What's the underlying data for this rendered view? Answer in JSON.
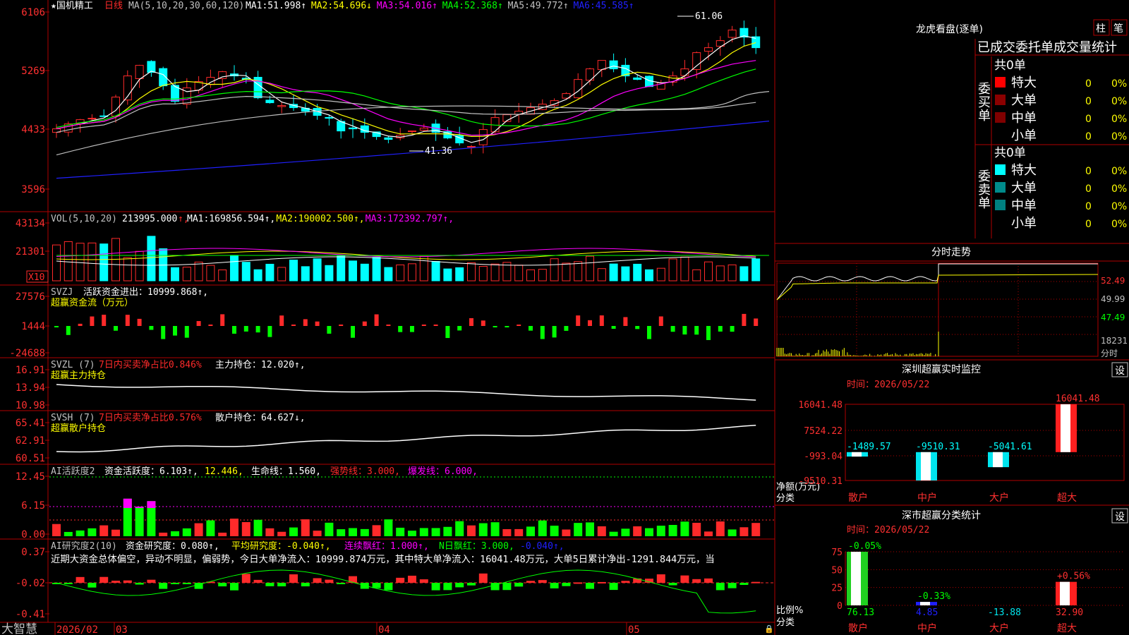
{
  "colors": {
    "up": "#ff2a2a",
    "down": "#00ffff",
    "frame": "#b00000",
    "bg": "#000000",
    "ma1": "#ffffff",
    "ma2": "#ffff00",
    "ma3": "#ff00ff",
    "ma4": "#00ff00",
    "ma5": "#c0c0c0",
    "ma6": "#2020ff",
    "green": "#00ff00",
    "magenta": "#ff00ff",
    "yellow": "#ffff00"
  },
  "candle": {
    "title": "★国机精工",
    "period": "日线",
    "ma_label": "MA(5,10,20,30,60,120)",
    "ma_values": [
      {
        "name": "MA1",
        "value": "51.998",
        "arrow": "↑"
      },
      {
        "name": "MA2",
        "value": "54.696",
        "arrow": "↓"
      },
      {
        "name": "MA3",
        "value": "54.016",
        "arrow": "↑"
      },
      {
        "name": "MA4",
        "value": "52.368",
        "arrow": "↑"
      },
      {
        "name": "MA5",
        "value": "49.772",
        "arrow": "↑"
      },
      {
        "name": "MA6",
        "value": "45.585",
        "arrow": "↑"
      }
    ],
    "y_ticks": [
      "6106",
      "5269",
      "4433",
      "3596"
    ],
    "high_label": "61.06",
    "low_label": "41.36"
  },
  "vol": {
    "label": "VOL(5,10,20)",
    "value": "213995.000",
    "ma": [
      {
        "name": "MA1",
        "value": "169856.594"
      },
      {
        "name": "MA2",
        "value": "190002.500"
      },
      {
        "name": "MA3",
        "value": "172392.797"
      }
    ],
    "y_ticks": [
      "43134",
      "21301"
    ],
    "unit": "X10"
  },
  "svzj": {
    "label": "SVZJ",
    "text": "活跃资金进出：10999.868↑,",
    "sub": "超赢资金流（万元）",
    "y_ticks": [
      "27576",
      "1444",
      "-24688"
    ]
  },
  "svzl": {
    "label": "SVZL (7)",
    "text1": "7日内买卖净占比0.846%",
    "text2": "主力持仓：12.020↑,",
    "sub": "超赢主力持仓",
    "y_ticks": [
      "16.91",
      "13.94",
      "10.98"
    ]
  },
  "svsh": {
    "label": "SVSH (7)",
    "text1": "7日内买卖净占比0.576%",
    "text2": "散户持仓：64.627↓,",
    "sub": "超赢散户持仓",
    "y_ticks": [
      "65.41",
      "62.91",
      "60.51"
    ]
  },
  "ai1": {
    "label": "AI活跃度2",
    "t1": "资金活跃度：6.103↑,",
    "t2": "12.446,",
    "t3": "生命线：1.560,",
    "t4": "强势线：3.000,",
    "t5": "爆发线：6.000,",
    "y_ticks": [
      "12.45",
      "6.15",
      "0.00"
    ]
  },
  "ai2": {
    "label": "AI研究度2(10)",
    "t1": "资金研究度：0.080↑,",
    "t2": "平均研究度：-0.040↑,",
    "t3": "连续飘红：1.000↑,",
    "t4": "N日飘红：3.000,",
    "t5": "-0.040↑,",
    "summary": "近期大资金总体偏空，异动不明显，偏弱势，今日大单净流入：10999.874万元，其中特大单净流入：16041.48万元，大单5日累计净出-1291.844万元，当",
    "y_ticks": [
      "0.37",
      "-0.02",
      "-0.41"
    ]
  },
  "x_axis": {
    "brand": "大智慧",
    "labels": [
      "2026/02",
      "03",
      "04",
      "05"
    ]
  },
  "dragon": {
    "title": "龙虎看盘(逐单)",
    "btn1": "柱",
    "btn2": "笔",
    "tabs": [
      "已成交",
      "委托单",
      "成交量统计"
    ],
    "buy": {
      "side": "委买单",
      "total": "共0单",
      "rows": [
        {
          "label": "特大",
          "count": "0",
          "pct": "0%",
          "color": "#ff0000"
        },
        {
          "label": "大单",
          "count": "0",
          "pct": "0%",
          "color": "#8b0000"
        },
        {
          "label": "中单",
          "count": "0",
          "pct": "0%",
          "color": "#800000"
        },
        {
          "label": "小单",
          "count": "0",
          "pct": "0%",
          "color": ""
        }
      ]
    },
    "sell": {
      "side": "委卖单",
      "total": "共0单",
      "rows": [
        {
          "label": "特大",
          "count": "0",
          "pct": "0%",
          "color": "#00ffff"
        },
        {
          "label": "大单",
          "count": "0",
          "pct": "0%",
          "color": "#008b8b"
        },
        {
          "label": "中单",
          "count": "0",
          "pct": "0%",
          "color": "#008080"
        },
        {
          "label": "小单",
          "count": "0",
          "pct": "0%",
          "color": ""
        }
      ]
    }
  },
  "intraday": {
    "title": "分时走势",
    "right_ticks": [
      "52.49",
      "49.99",
      "47.49",
      "18231",
      "分时"
    ]
  },
  "sz_monitor": {
    "title": "深圳超赢实时监控",
    "btn": "设",
    "time": "时间：2026/05/22",
    "y_ticks": [
      "16041.48",
      "7524.22",
      "-993.04",
      "-9510.31"
    ],
    "ylabel": "净额(万元)",
    "xlabel": "分类",
    "chart_data": {
      "type": "bar",
      "categories": [
        "散户",
        "中户",
        "大户",
        "超大"
      ],
      "values": [
        -1489.57,
        -9510.31,
        -5041.61,
        16041.48
      ],
      "data_labels": [
        "-1489.57",
        "-9510.31",
        "-5041.61",
        "16041.48"
      ],
      "ylim": [
        -9510.31,
        16041.48
      ]
    }
  },
  "sz_class": {
    "title": "深市超赢分类统计",
    "btn": "设",
    "time": "时间：2026/05/22",
    "y_ticks": [
      "75",
      "50",
      "25",
      "0"
    ],
    "ylabel": "比例%",
    "xlabel": "分类",
    "chart_data": {
      "type": "bar",
      "categories": [
        "散户",
        "中户",
        "大户",
        "超大"
      ],
      "values": [
        76.13,
        4.85,
        -13.88,
        32.9
      ],
      "changes": [
        "-0.05%",
        "-0.33%",
        "",
        "+0.56%"
      ],
      "value_labels": [
        "76.13",
        "4.85",
        "-13.88",
        "32.90"
      ],
      "ylim": [
        0,
        75
      ]
    }
  }
}
